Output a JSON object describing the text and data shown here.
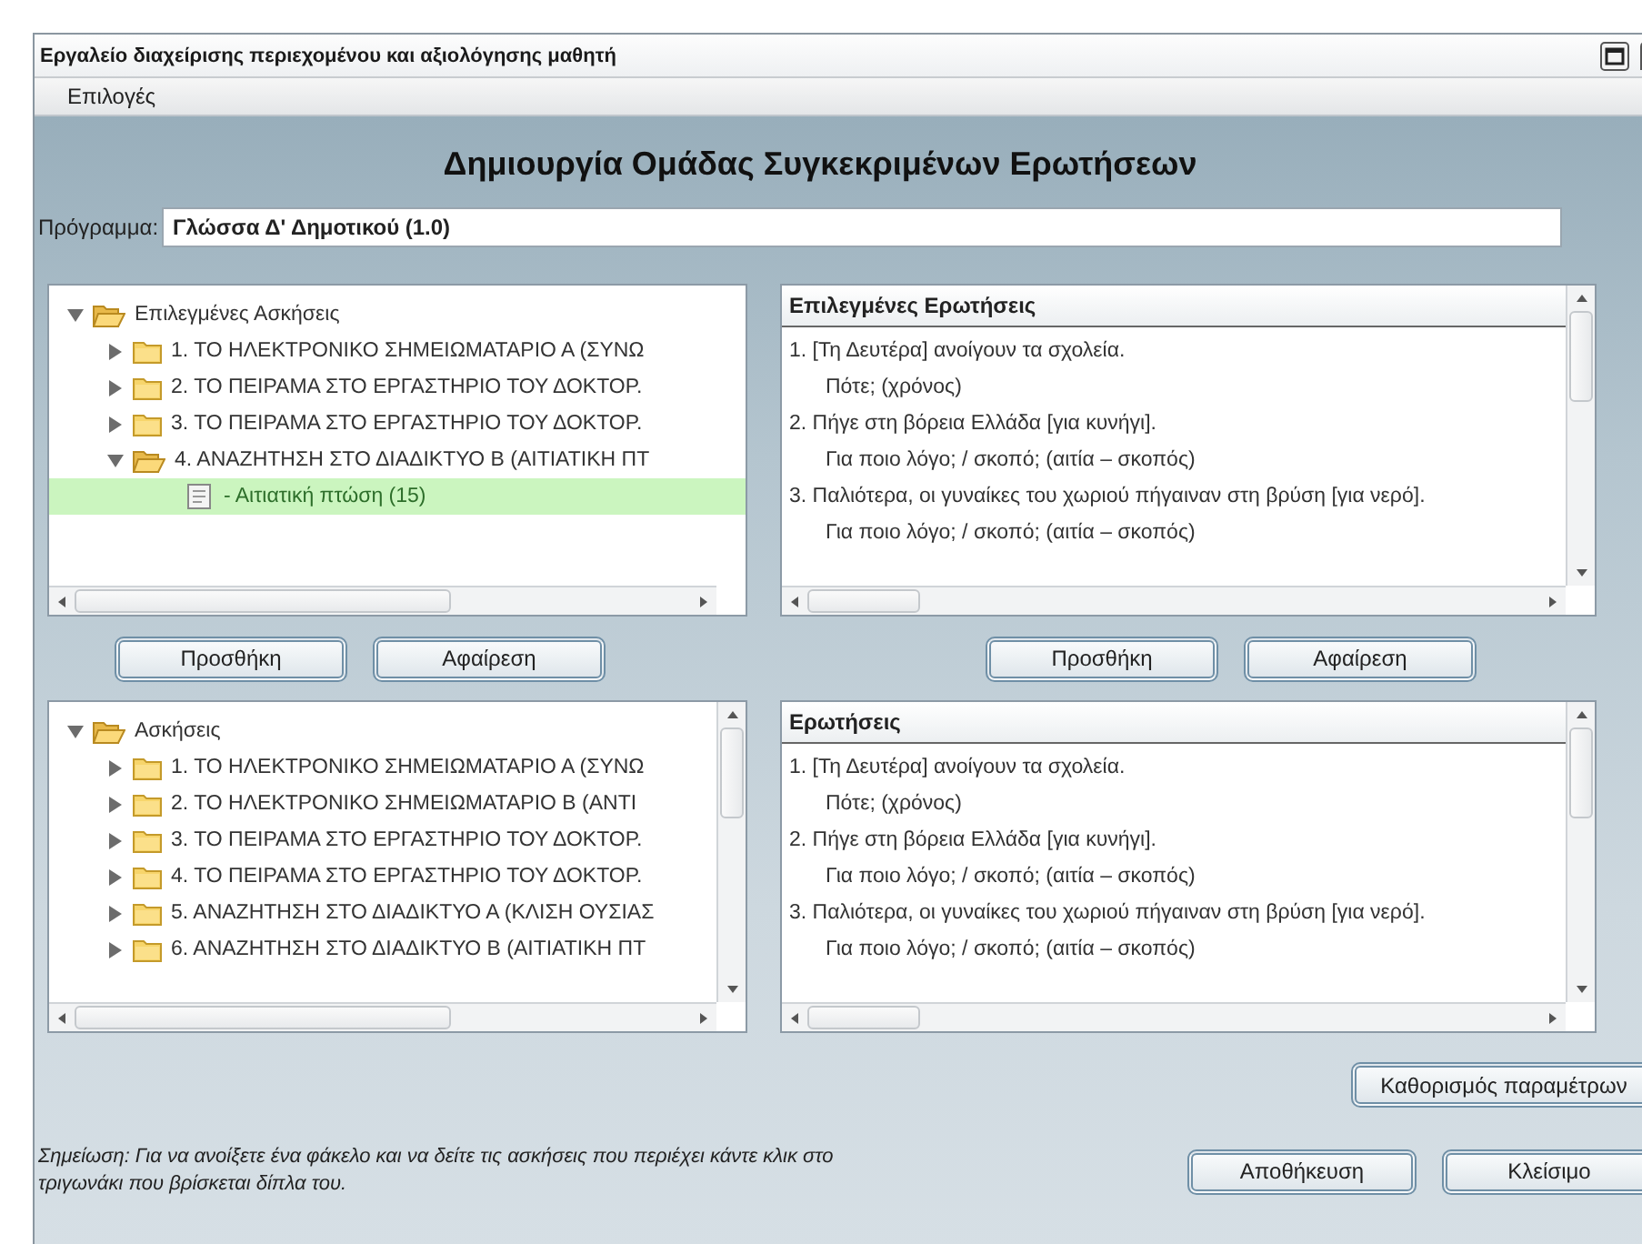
{
  "window": {
    "title": "Εργαλείο διαχείρισης περιεχομένου και αξιολόγησης μαθητή"
  },
  "menu": [
    "Επιλογές"
  ],
  "heading": "Δημιουργία Ομάδας Συγκεκριμένων Ερωτήσεων",
  "program": {
    "label": "Πρόγραμμα:",
    "value": "Γλώσσα Δ' Δημοτικού (1.0)"
  },
  "selected_exercises": {
    "tree": [
      {
        "label": "Επιλεγμένες Ασκήσεις",
        "kind": "folder",
        "expanded": true,
        "selected": false,
        "children": [
          {
            "label": "1.  ΤΟ ΗΛΕΚΤΡΟΝΙΚΟ ΣΗΜΕΙΩΜΑΤΑΡΙΟ Α (ΣΥΝΩ",
            "kind": "folder",
            "expanded": false,
            "selected": false
          },
          {
            "label": "2.  ΤΟ ΠΕΙΡΑΜΑ ΣΤΟ ΕΡΓΑΣΤΗΡΙΟ ΤΟΥ ΔΟΚΤΟΡ.",
            "kind": "folder",
            "expanded": false,
            "selected": false
          },
          {
            "label": "3.  ΤΟ ΠΕΙΡΑΜΑ ΣΤΟ ΕΡΓΑΣΤΗΡΙΟ ΤΟΥ ΔΟΚΤΟΡ.",
            "kind": "folder",
            "expanded": false,
            "selected": false
          },
          {
            "label": "4.  ΑΝΑΖΗΤΗΣΗ ΣΤΟ ΔΙΑΔΙΚΤΥΟ Β (ΑΙΤΙΑΤΙΚΗ ΠΤ",
            "kind": "folder",
            "expanded": true,
            "selected": false,
            "children": [
              {
                "label": "- Αιτιατική πτώση  (15)",
                "kind": "leaf",
                "selected": true
              }
            ]
          }
        ]
      }
    ],
    "buttons": [
      "Προσθήκη",
      "Αφαίρεση"
    ]
  },
  "selected_questions": {
    "title": "Επιλεγμένες Ερωτήσεις",
    "items": [
      {
        "text": "1. [Τη Δευτέρα] ανοίγουν τα σχολεία.",
        "kind": "question"
      },
      {
        "text": "Πότε; (χρόνος)",
        "kind": "answer"
      },
      {
        "text": "2. Πήγε στη βόρεια Ελλάδα [για κυνήγι].",
        "kind": "question"
      },
      {
        "text": "Για ποιο λόγο; / σκοπό; (αιτία – σκοπός)",
        "kind": "answer"
      },
      {
        "text": "3. Παλιότερα, οι γυναίκες του χωριού πήγαιναν στη βρύση [για νερό].",
        "kind": "question"
      },
      {
        "text": "Για ποιο λόγο; / σκοπό; (αιτία – σκοπός)",
        "kind": "answer"
      }
    ],
    "buttons": [
      "Προσθήκη",
      "Αφαίρεση"
    ]
  },
  "exercises": {
    "tree": [
      {
        "label": "Ασκήσεις",
        "kind": "folder",
        "expanded": true,
        "selected": false,
        "children": [
          {
            "label": "1.  ΤΟ ΗΛΕΚΤΡΟΝΙΚΟ ΣΗΜΕΙΩΜΑΤΑΡΙΟ Α (ΣΥΝΩ",
            "kind": "folder",
            "expanded": false,
            "selected": false
          },
          {
            "label": "2.  ΤΟ ΗΛΕΚΤΡΟΝΙΚΟ ΣΗΜΕΙΩΜΑΤΑΡΙΟ Β (ΑΝΤΙ",
            "kind": "folder",
            "expanded": false,
            "selected": false
          },
          {
            "label": "3.  ΤΟ ΠΕΙΡΑΜΑ ΣΤΟ ΕΡΓΑΣΤΗΡΙΟ ΤΟΥ ΔΟΚΤΟΡ.",
            "kind": "folder",
            "expanded": false,
            "selected": false
          },
          {
            "label": "4.  ΤΟ ΠΕΙΡΑΜΑ ΣΤΟ ΕΡΓΑΣΤΗΡΙΟ ΤΟΥ ΔΟΚΤΟΡ.",
            "kind": "folder",
            "expanded": false,
            "selected": false
          },
          {
            "label": "5.  ΑΝΑΖΗΤΗΣΗ ΣΤΟ ΔΙΑΔΙΚΤΥΟ Α (ΚΛΙΣΗ ΟΥΣΙΑΣ",
            "kind": "folder",
            "expanded": false,
            "selected": false
          },
          {
            "label": "6.  ΑΝΑΖΗΤΗΣΗ ΣΤΟ ΔΙΑΔΙΚΤΥΟ Β (ΑΙΤΙΑΤΙΚΗ ΠΤ",
            "kind": "folder",
            "expanded": false,
            "selected": false
          }
        ]
      }
    ]
  },
  "questions": {
    "title": "Ερωτήσεις",
    "items": [
      {
        "text": "1. [Τη Δευτέρα] ανοίγουν τα σχολεία.",
        "kind": "question"
      },
      {
        "text": "Πότε; (χρόνος)",
        "kind": "answer"
      },
      {
        "text": "2. Πήγε στη βόρεια Ελλάδα [για κυνήγι].",
        "kind": "question"
      },
      {
        "text": "Για ποιο λόγο; / σκοπό; (αιτία – σκοπός)",
        "kind": "answer"
      },
      {
        "text": "3. Παλιότερα, οι γυναίκες του χωριού πήγαιναν στη βρύση [για νερό].",
        "kind": "question"
      },
      {
        "text": "Για ποιο λόγο; / σκοπό; (αιτία – σκοπός)",
        "kind": "answer"
      }
    ]
  },
  "parameters_button": "Καθορισμός παραμέτρων",
  "note": "Σημείωση: Για να ανοίξετε ένα φάκελο και να δείτε τις ασκήσεις που περιέχει κάντε κλικ στο τριγωνάκι που βρίσκεται δίπλα του.",
  "footer_buttons": [
    "Αποθήκευση",
    "Κλείσιμο"
  ]
}
